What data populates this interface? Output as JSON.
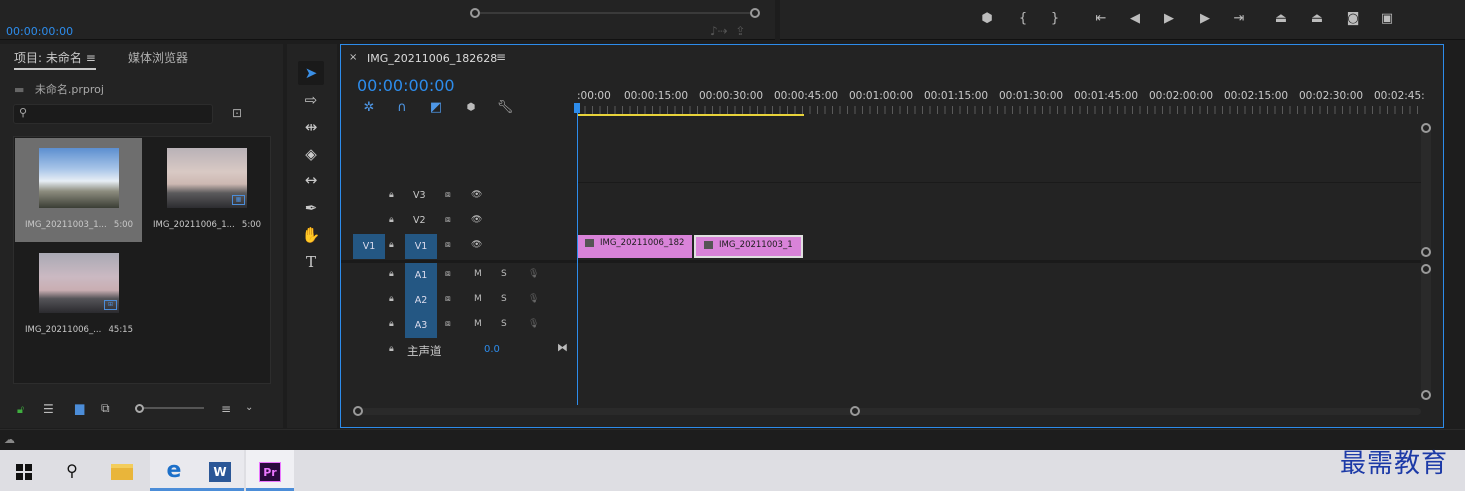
{
  "source_monitor": {
    "timecode": "00:00:00:00"
  },
  "project_panel": {
    "tab_project": "项目: 未命名",
    "tab_media": "媒体浏览器",
    "file_name": "未命名.prproj",
    "search_placeholder": "",
    "clips": [
      {
        "name": "IMG_20211003_1...",
        "duration": "5:00"
      },
      {
        "name": "IMG_20211006_1...",
        "duration": "5:00"
      },
      {
        "name": "IMG_20211006_...",
        "duration": "45:15"
      }
    ]
  },
  "timeline": {
    "title": "IMG_20211006_182628",
    "timecode": "00:00:00:00",
    "ruler": [
      ":00:00",
      "00:00:15:00",
      "00:00:30:00",
      "00:00:45:00",
      "00:01:00:00",
      "00:01:15:00",
      "00:01:30:00",
      "00:01:45:00",
      "00:02:00:00",
      "00:02:15:00",
      "00:02:30:00",
      "00:02:45:"
    ],
    "video_tracks": [
      "V3",
      "V2",
      "V1"
    ],
    "audio_tracks": [
      "A1",
      "A2",
      "A3"
    ],
    "source_patch_video": "V1",
    "mute": "M",
    "solo": "S",
    "master": {
      "label": "主声道",
      "value": "0.0"
    },
    "clips": [
      {
        "name": "IMG_20211006_182"
      },
      {
        "name": "IMG_20211003_1"
      }
    ]
  },
  "watermark": "最需教育",
  "colors": {
    "accent": "#2d8ceb",
    "clip": "#d983d9",
    "workbar": "#e8d33a"
  }
}
